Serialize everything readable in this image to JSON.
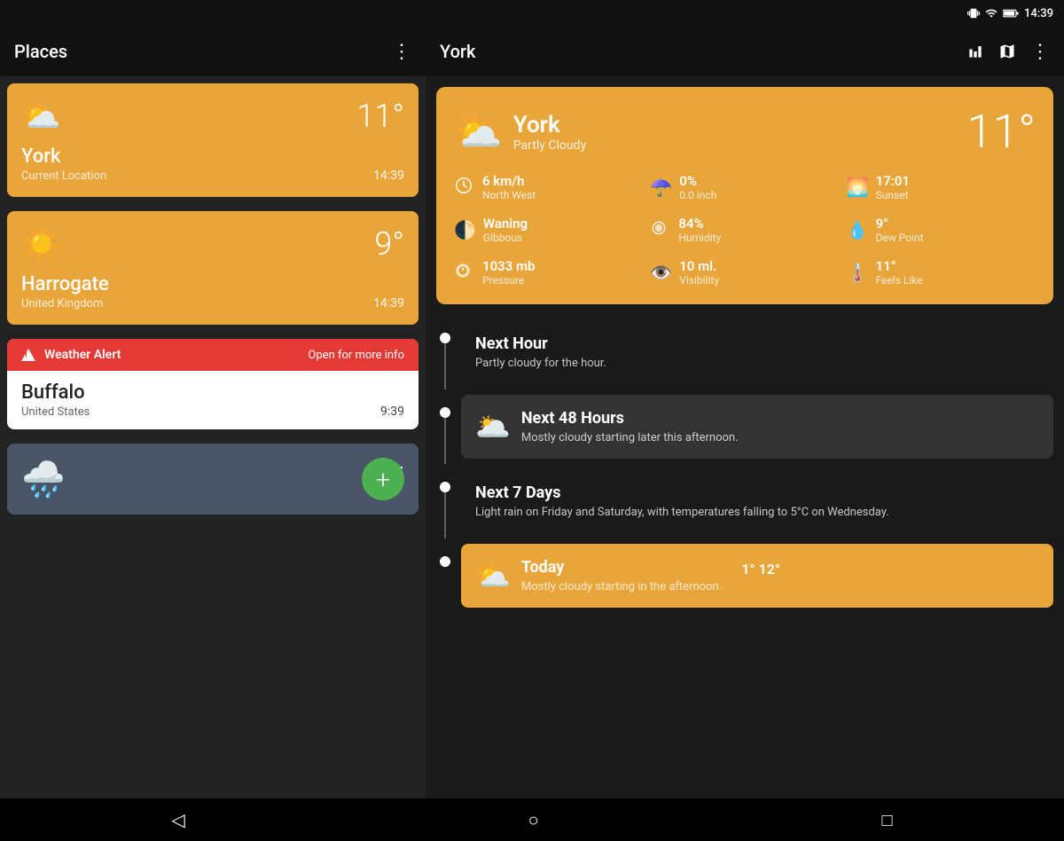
{
  "statusBar": {
    "time": "14:39",
    "icons": [
      "vibrate",
      "wifi",
      "battery"
    ]
  },
  "leftPanel": {
    "title": "Places",
    "moreIcon": "⋮",
    "cards": [
      {
        "id": "york",
        "city": "York",
        "subtitle": "Current Location",
        "temp": "11°",
        "time": "14:39",
        "type": "orange",
        "icon": "partly-cloudy"
      },
      {
        "id": "harrogate",
        "city": "Harrogate",
        "subtitle": "United Kingdom",
        "temp": "9°",
        "time": "14:39",
        "type": "orange",
        "icon": "sun"
      },
      {
        "id": "buffalo",
        "city": "Buffalo",
        "subtitle": "United States",
        "temp": "",
        "time": "9:39",
        "type": "white",
        "icon": "",
        "alert": {
          "label": "Weather Alert",
          "link": "Open for more info"
        }
      },
      {
        "id": "fourth",
        "city": "",
        "subtitle": "",
        "temp": "25",
        "time": "",
        "type": "gray",
        "icon": "cloud-rain"
      }
    ],
    "addButton": "+"
  },
  "rightPanel": {
    "title": "York",
    "icons": [
      "chart",
      "map",
      "more"
    ],
    "mainCard": {
      "city": "York",
      "condition": "Partly Cloudy",
      "temp": "11°",
      "details": [
        {
          "icon": "wind",
          "value": "6 km/h",
          "label": "North West"
        },
        {
          "icon": "umbrella",
          "value": "0%",
          "label": "0.0 inch"
        },
        {
          "icon": "sunset",
          "value": "17:01",
          "label": "Sunset"
        },
        {
          "icon": "moon",
          "value": "Waning",
          "label": "Gibbous"
        },
        {
          "icon": "target",
          "value": "84%",
          "label": "Humidity"
        },
        {
          "icon": "droplet",
          "value": "9°",
          "label": "Dew Point"
        },
        {
          "icon": "pressure",
          "value": "1033 mb",
          "label": "Pressure"
        },
        {
          "icon": "eye",
          "value": "10 ml.",
          "label": "Visibility"
        },
        {
          "icon": "thermometer",
          "value": "11°",
          "label": "Feels Like"
        }
      ]
    },
    "forecasts": [
      {
        "id": "next-hour",
        "title": "Next Hour",
        "subtitle": "Partly cloudy for the hour.",
        "type": "transparent",
        "icon": "",
        "extra": ""
      },
      {
        "id": "next-48",
        "title": "Next 48 Hours",
        "subtitle": "Mostly cloudy starting later this afternoon.",
        "type": "dark",
        "icon": "mostly-cloudy",
        "extra": ""
      },
      {
        "id": "next-7",
        "title": "Next 7 Days",
        "subtitle": "Light rain on Friday and Saturday, with temperatures falling to 5°C on Wednesday.",
        "type": "transparent",
        "icon": "",
        "extra": ""
      },
      {
        "id": "today",
        "title": "Today",
        "subtitle": "Mostly cloudy starting in the afternoon.",
        "type": "orange",
        "icon": "partly-cloudy",
        "extra": "1° 12°"
      }
    ]
  },
  "bottomNav": {
    "back": "◁",
    "home": "○",
    "recent": "□"
  }
}
